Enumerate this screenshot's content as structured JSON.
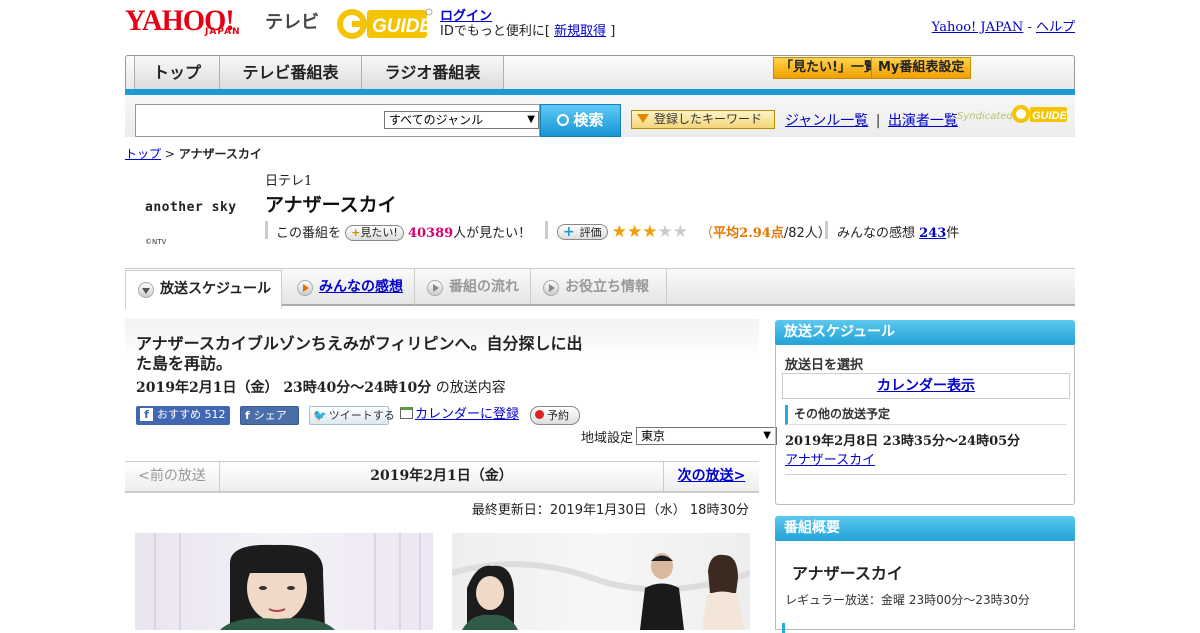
{
  "header": {
    "yahoo_logo": "YAHOO!",
    "japan_logo": "JAPAN",
    "tv_label": "テレビ",
    "gguide_logo": "G-GUIDE",
    "login": "ログイン",
    "id_text_before": "IDでもっと便利に[",
    "signup": "新規取得",
    "id_text_after": "]",
    "yahoo_japan_link": "Yahoo! JAPAN",
    "dash": "-",
    "help_link": "ヘルプ"
  },
  "nav": {
    "tabs": [
      "トップ",
      "テレビ番組表",
      "ラジオ番組表"
    ],
    "want_list": "「見たい!」一覧",
    "my_schedule": "My番組表設定"
  },
  "search": {
    "genre_selected": "すべてのジャンル",
    "search_button": "検索",
    "keyword_button": "登録したキーワード",
    "genre_list": "ジャンル一覧",
    "pipe": "|",
    "cast_list": "出演者一覧",
    "syndicated": "Syndicated"
  },
  "breadcrumb": {
    "top": "トップ",
    "sep": ">",
    "current": "アナザースカイ"
  },
  "program": {
    "image_text": "another sky",
    "image_credit": "©NTV",
    "channel": "日テレ1",
    "title": "アナザースカイ",
    "want_prefix": "この番組を",
    "want_button": "見たい!",
    "want_count": "40389",
    "want_suffix": "人が見たい！",
    "rate_button": "評価",
    "rating_value": 2.94,
    "rating_open": "（",
    "rating_avg_label": "平均2.94点",
    "rating_count": "/82人）",
    "kansou_label": "みんなの感想",
    "kansou_count": "243",
    "kansou_unit": "件"
  },
  "tabs": [
    {
      "label": "放送スケジュール"
    },
    {
      "label": "みんなの感想"
    },
    {
      "label": "番組の流れ"
    },
    {
      "label": "お役立ち情報"
    }
  ],
  "episode": {
    "title": "アナザースカイブルゾンちえみがフィリピンへ。自分探しに出た島を再訪。",
    "date": "2019年2月1日（金） 23時40分～24時10分",
    "date_suffix": "の放送内容",
    "fb_recommend": "おすすめ",
    "fb_count": "512",
    "fb_share": "シェア",
    "tweet": "ツイートする",
    "calendar": "カレンダーに登録",
    "reserve": "予約",
    "region_label": "地域設定",
    "region_value": "東京",
    "prev": "<前の放送",
    "current_date": "2019年2月1日（金）",
    "next": "次の放送>",
    "updated": "最終更新日：2019年1月30日（水） 18時30分"
  },
  "sidebar": {
    "schedule_header": "放送スケジュール",
    "select_date": "放送日を選択",
    "calendar_link": "カレンダー表示",
    "other_label": "その他の放送予定",
    "other_date": "2019年2月8日 23時35分～24時05分",
    "other_title": "アナザースカイ",
    "overview_header": "番組概要",
    "overview_title": "アナザースカイ",
    "regular": "レギュラー放送：金曜 23時00分～23時30分"
  },
  "colors": {
    "accent_blue": "#1d9ad6",
    "yahoo_red": "#e60012",
    "pink": "#d6006f",
    "orange": "#e77400"
  }
}
